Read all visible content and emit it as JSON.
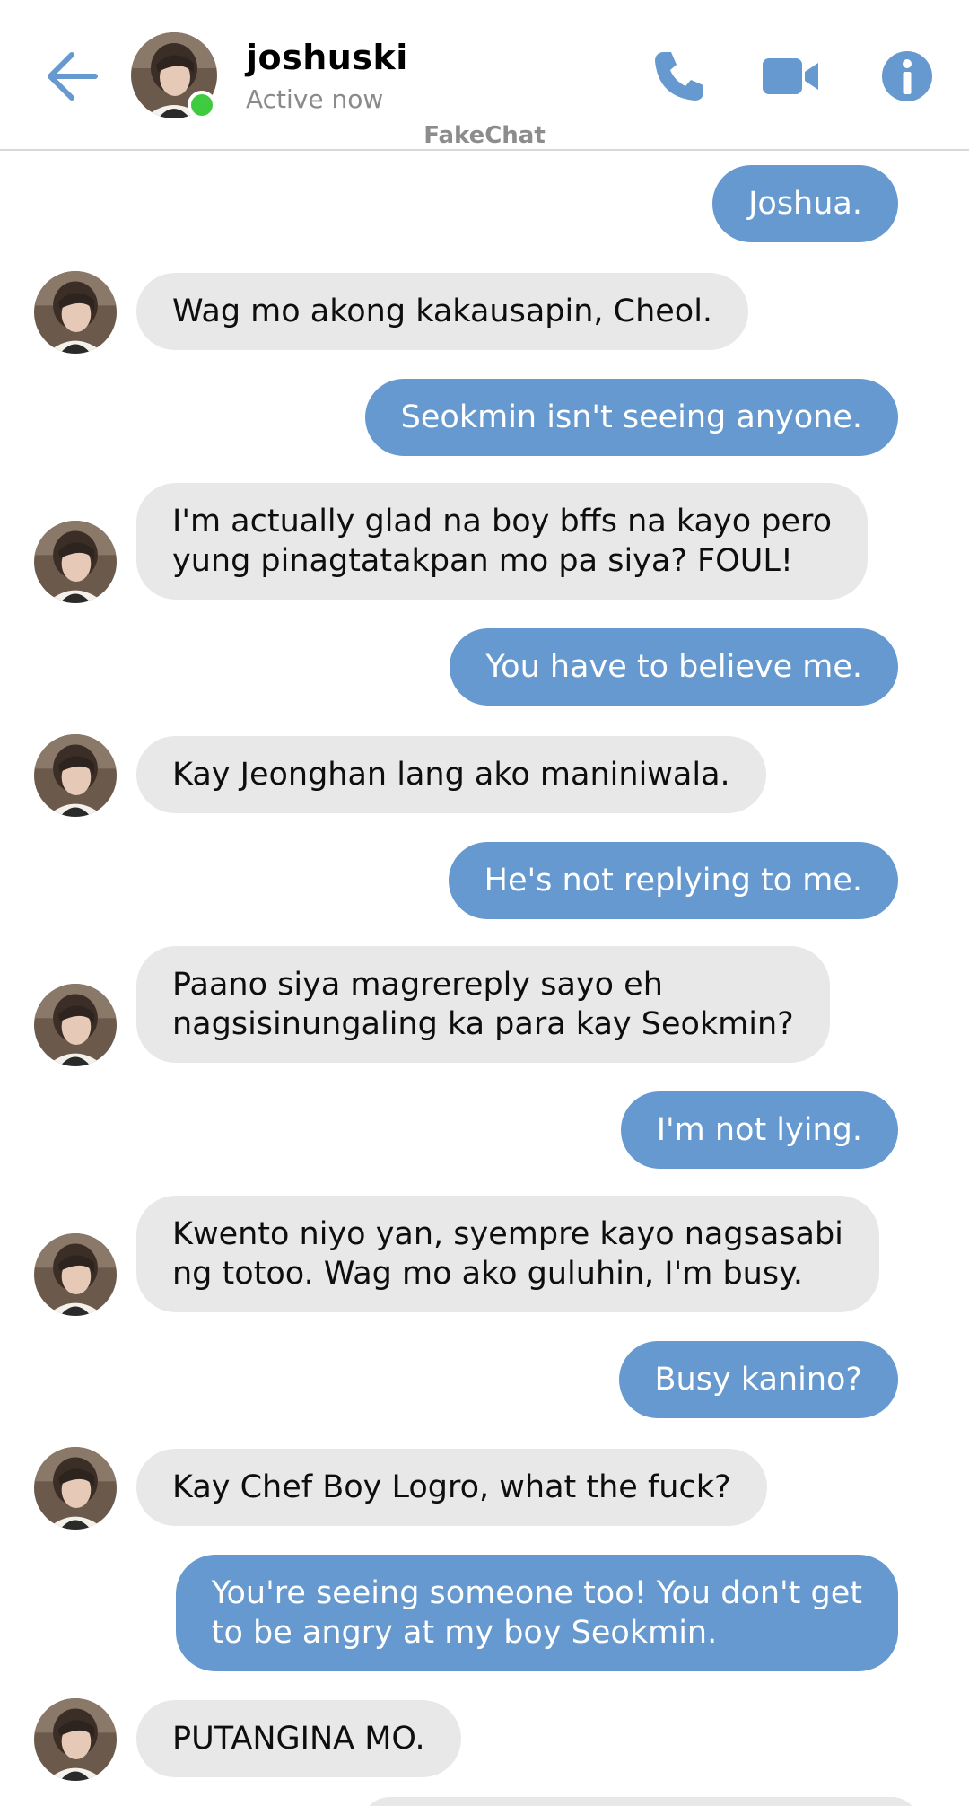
{
  "header": {
    "contact_name": "joshuski",
    "contact_status": "Active now",
    "watermark": "FakeChat",
    "icons": {
      "back": "arrow-left-icon",
      "phone": "phone-icon",
      "video": "video-camera-icon",
      "info": "info-icon"
    },
    "accent_color": "#6599cf",
    "online_color": "#3fcb3f"
  },
  "messages": [
    {
      "from": "me",
      "text": "Joshua."
    },
    {
      "from": "them",
      "text": "Wag mo akong kakausapin, Cheol."
    },
    {
      "from": "me",
      "text": "Seokmin isn't seeing anyone."
    },
    {
      "from": "them",
      "text": "I'm actually glad na boy bffs na kayo pero\nyung pinagtatakpan mo pa siya? FOUL!"
    },
    {
      "from": "me",
      "text": "You have to believe me."
    },
    {
      "from": "them",
      "text": "Kay Jeonghan lang ako maniniwala."
    },
    {
      "from": "me",
      "text": "He's not replying to me."
    },
    {
      "from": "them",
      "text": "Paano siya magrereply sayo eh\nnagsisinungaling ka para kay Seokmin?"
    },
    {
      "from": "me",
      "text": "I'm not lying."
    },
    {
      "from": "them",
      "text": "Kwento niyo yan, syempre kayo nagsasabi\nng totoo. Wag mo ako guluhin, I'm busy."
    },
    {
      "from": "me",
      "text": "Busy kanino?"
    },
    {
      "from": "them",
      "text": "Kay Chef Boy Logro, what the fuck?"
    },
    {
      "from": "me",
      "text": "You're seeing someone too! You don't get\nto be angry at my boy Seokmin."
    },
    {
      "from": "them",
      "text": "PUTANGINA MO."
    }
  ]
}
